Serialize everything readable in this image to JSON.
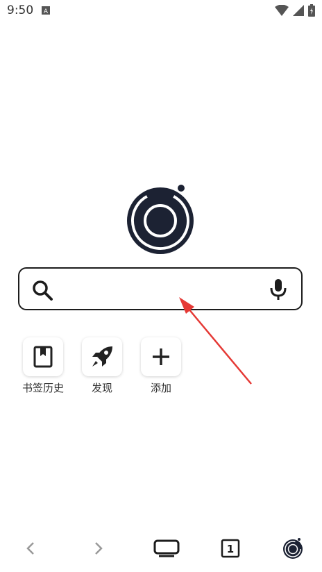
{
  "status_bar": {
    "time": "9:50",
    "notification_icon": "A"
  },
  "search": {
    "placeholder": "",
    "value": ""
  },
  "shortcuts": [
    {
      "label": "书签历史",
      "icon": "bookmark-icon"
    },
    {
      "label": "发现",
      "icon": "rocket-icon"
    },
    {
      "label": "添加",
      "icon": "plus-icon"
    }
  ],
  "bottom_nav": {
    "tab_count": "1"
  },
  "colors": {
    "dark": "#1c2233",
    "accent_arrow": "#e53935"
  }
}
